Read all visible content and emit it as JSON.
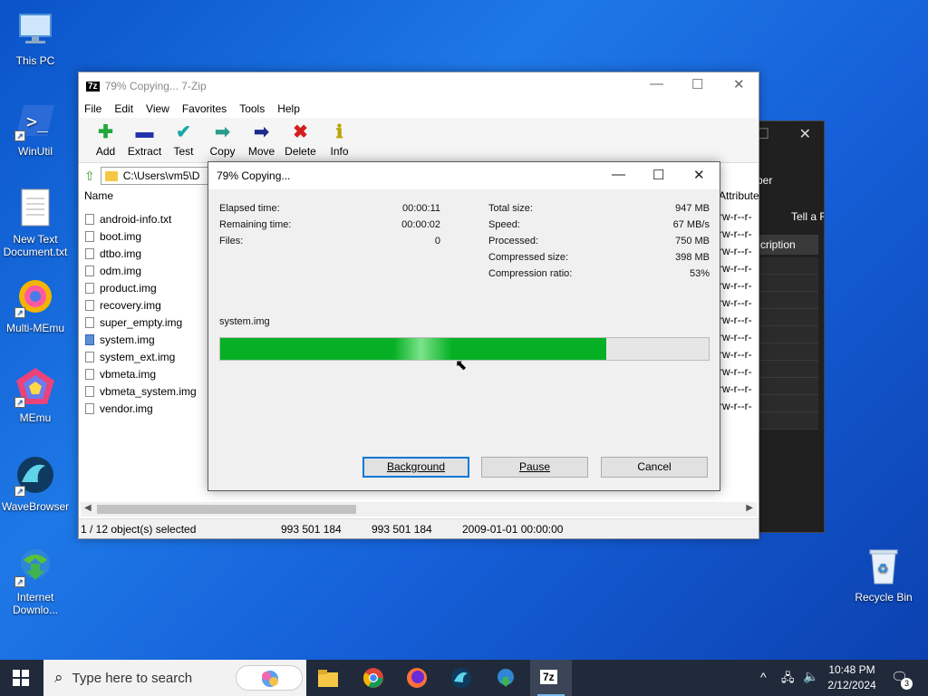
{
  "desktop": {
    "icons": [
      {
        "label": "This PC"
      },
      {
        "label": "WinUtil"
      },
      {
        "label": "New Text Document.txt"
      },
      {
        "label": "Multi-MEmu"
      },
      {
        "label": "MEmu"
      },
      {
        "label": "WaveBrowser"
      },
      {
        "label": "Internet Downlo..."
      },
      {
        "label": "Recycle Bin"
      }
    ]
  },
  "background_window": {
    "toolbar_labels": [
      "ber",
      "Tell a Fr"
    ],
    "column": "cription"
  },
  "window": {
    "title": "79% Copying... 7-Zip",
    "menu": [
      "File",
      "Edit",
      "View",
      "Favorites",
      "Tools",
      "Help"
    ],
    "toolbar": [
      "Add",
      "Extract",
      "Test",
      "Copy",
      "Move",
      "Delete",
      "Info"
    ],
    "address": "C:\\Users\\vm5\\D",
    "columns": {
      "name": "Name",
      "attributes": "Attribute"
    },
    "files": [
      "android-info.txt",
      "boot.img",
      "dtbo.img",
      "odm.img",
      "product.img",
      "recovery.img",
      "super_empty.img",
      "system.img",
      "system_ext.img",
      "vbmeta.img",
      "vbmeta_system.img",
      "vendor.img"
    ],
    "attr_value": "rw-r--r-",
    "status": {
      "selected": "1 / 12 object(s) selected",
      "size": "993 501 184",
      "packed": "993 501 184",
      "date": "2009-01-01 00:00:00"
    }
  },
  "dialog": {
    "title": "79% Copying...",
    "left": [
      {
        "label": "Elapsed time:",
        "value": "00:00:11"
      },
      {
        "label": "Remaining time:",
        "value": "00:00:02"
      },
      {
        "label": "Files:",
        "value": "0"
      }
    ],
    "right": [
      {
        "label": "Total size:",
        "value": "947 MB"
      },
      {
        "label": "Speed:",
        "value": "67 MB/s"
      },
      {
        "label": "Processed:",
        "value": "750 MB"
      },
      {
        "label": "Compressed size:",
        "value": "398 MB"
      },
      {
        "label": "Compression ratio:",
        "value": "53%"
      }
    ],
    "current_file": "system.img",
    "progress_percent": 79,
    "buttons": {
      "background": "Background",
      "pause": "Pause",
      "cancel": "Cancel"
    }
  },
  "taskbar": {
    "search_placeholder": "Type here to search",
    "time": "10:48 PM",
    "date": "2/12/2024",
    "notification_count": "3",
    "active_app_label": "7z"
  },
  "colors": {
    "progress": "#06b025",
    "desktop": "#1560d8",
    "taskbar": "#202a3a"
  }
}
